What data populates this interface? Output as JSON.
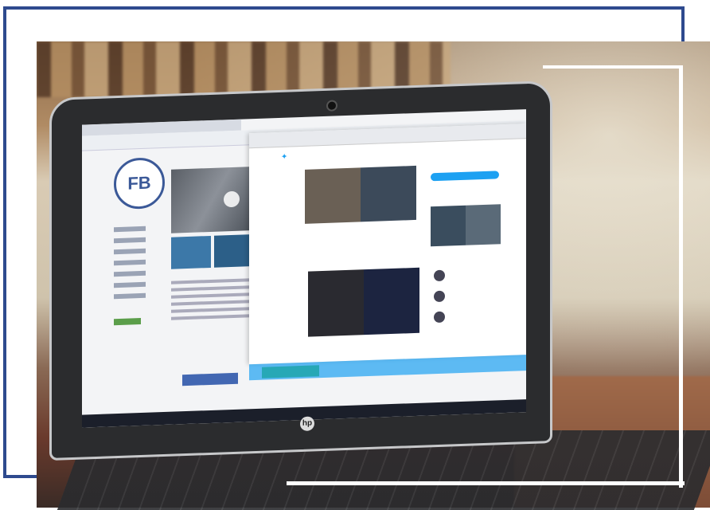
{
  "laptop": {
    "screen": {
      "facebook_page": {
        "avatar_text": "FB",
        "buttons": {
          "login_label": "",
          "create_label": ""
        }
      },
      "twitter_page": {
        "title": "",
        "icon_name": "twitter-bird-icon"
      }
    },
    "brand_logo": "hp"
  },
  "colors": {
    "frame_blue": "#2e4a8e",
    "facebook_blue": "#3b5998",
    "twitter_blue": "#1da1f2"
  }
}
